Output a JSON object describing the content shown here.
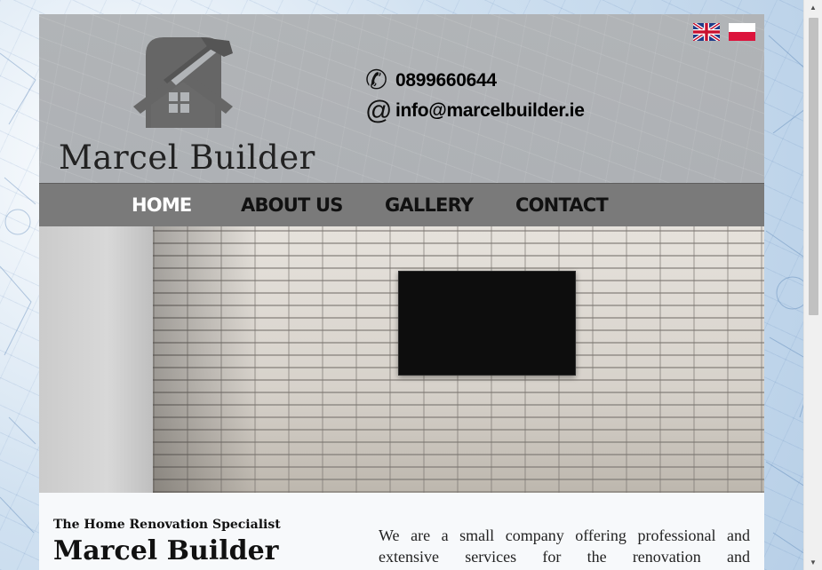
{
  "header": {
    "logo_text": "Marcel Builder",
    "phone": "0899660644",
    "email": "info@marcelbuilder.ie",
    "phone_icon": "phone-icon",
    "email_icon": "at-icon",
    "languages": [
      "english-flag-icon",
      "polish-flag-icon"
    ]
  },
  "nav": {
    "items": [
      {
        "label": "HOME",
        "active": true
      },
      {
        "label": "ABOUT US"
      },
      {
        "label": "GALLERY"
      },
      {
        "label": "CONTACT"
      }
    ]
  },
  "content": {
    "tagline": "The Home Renovation Specialist",
    "title": "Marcel Builder",
    "intro": "We are a small company offering professional and extensive services for the renovation and"
  },
  "colors": {
    "header_bg": "#b1b4b7",
    "nav_bg": "#7a7a7a",
    "nav_active": "#ffffff"
  }
}
